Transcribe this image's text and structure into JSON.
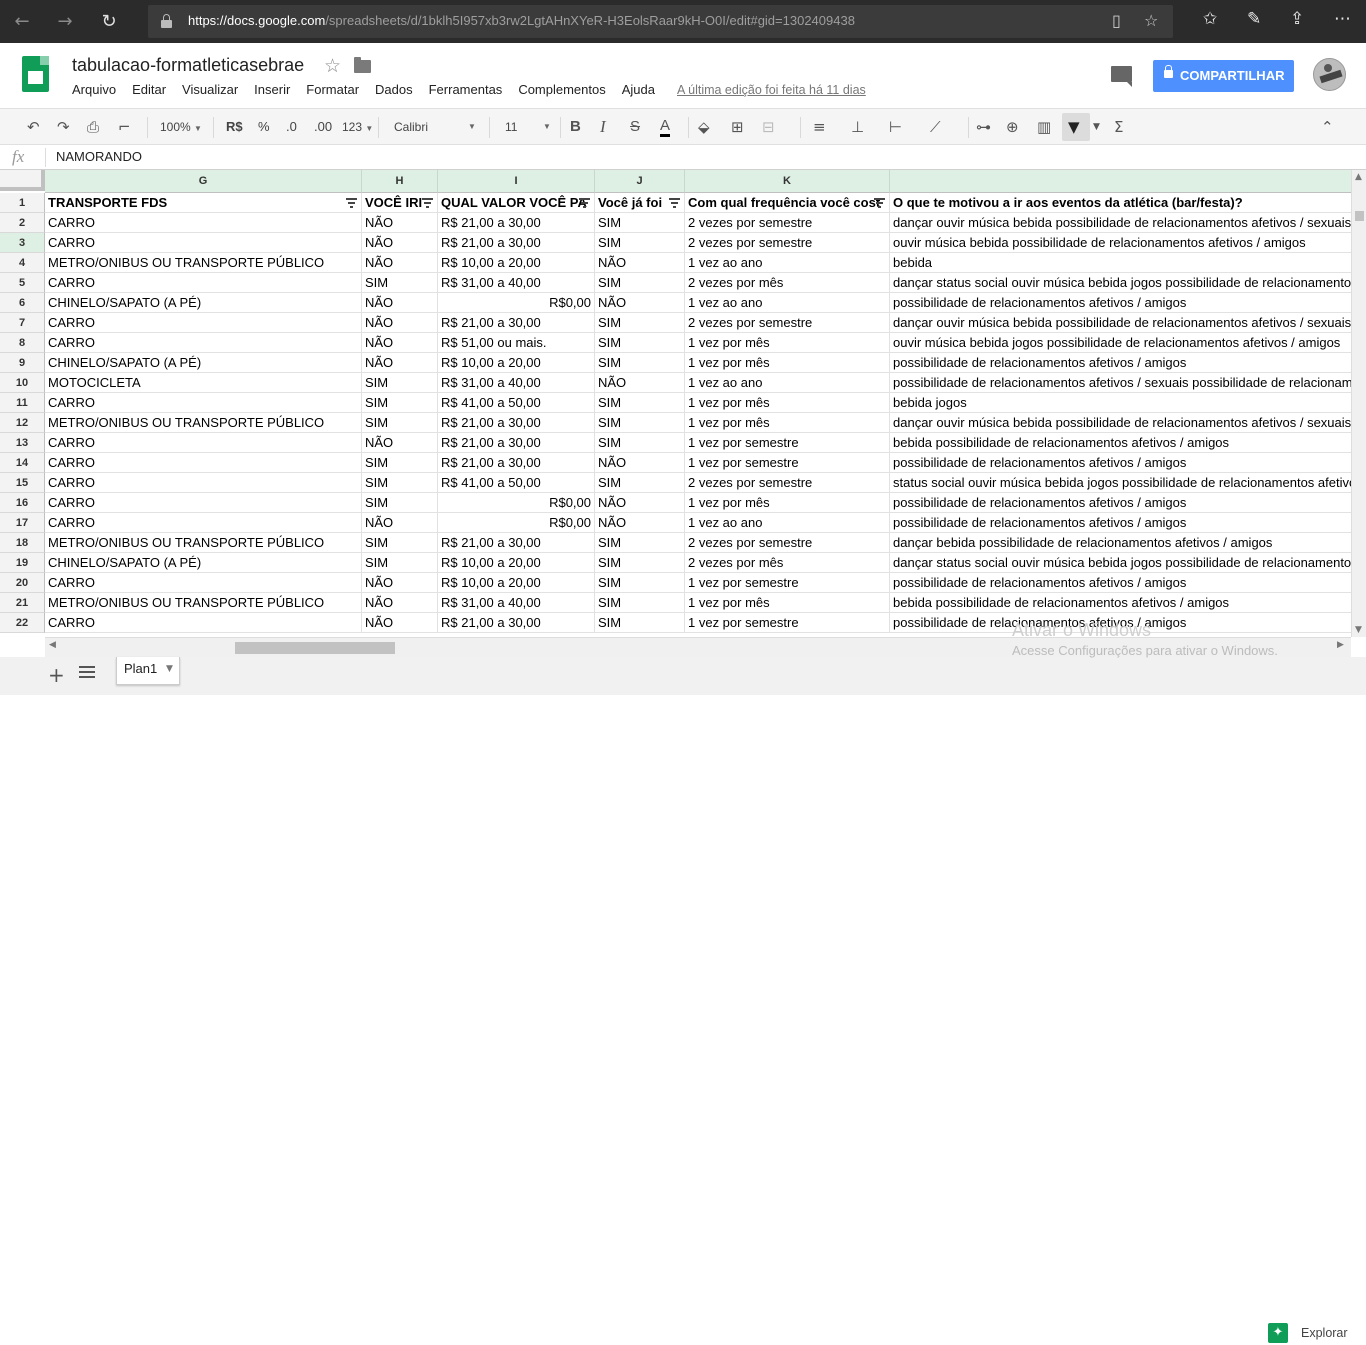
{
  "browser": {
    "url_host": "https://docs.google.com",
    "url_path": "/spreadsheets/d/1bklh5I957xb3rw2LgtAHnXYeR-H3EolsRaar9kH-O0I/edit#gid=1302409438"
  },
  "doc": {
    "title": "tabulacao-formatleticasebrae",
    "menu": [
      "Arquivo",
      "Editar",
      "Visualizar",
      "Inserir",
      "Formatar",
      "Dados",
      "Ferramentas",
      "Complementos",
      "Ajuda"
    ],
    "last_edit": "A última edição foi feita há 11 dias",
    "share_label": "COMPARTILHAR"
  },
  "toolbar": {
    "zoom": "100%",
    "currency": "R$",
    "percent": "%",
    "dec_less": ".0",
    "dec_more": ".00",
    "more_formats": "123",
    "font": "Calibri",
    "font_size": "11"
  },
  "formula": {
    "fx": "fx",
    "value": "NAMORANDO"
  },
  "sheet": {
    "columns": [
      "G",
      "H",
      "I",
      "J",
      "K",
      ""
    ],
    "header_row": [
      "TRANSPORTE FDS",
      "VOCÊ IRI",
      "QUAL VALOR VOCÊ PA",
      "Você já foi",
      "Com qual frequência você cost",
      "O que te motivou a ir aos eventos da atlética (bar/festa)?"
    ],
    "row_numbers": [
      "1",
      "2",
      "3",
      "4",
      "5",
      "6",
      "7",
      "8",
      "9",
      "10",
      "11",
      "12",
      "13",
      "14",
      "15",
      "16",
      "17",
      "18",
      "19",
      "20",
      "21",
      "22"
    ],
    "selected_row": "3",
    "rows": [
      [
        "CARRO",
        "NÃO",
        "R$ 21,00 a 30,00",
        "SIM",
        "2 vezes por semestre",
        "dançar ouvir música bebida possibilidade de relacionamentos afetivos / sexuais"
      ],
      [
        "CARRO",
        "NÃO",
        "R$ 21,00 a 30,00",
        "SIM",
        "2 vezes por semestre",
        "ouvir música bebida possibilidade de relacionamentos afetivos / amigos"
      ],
      [
        "METRO/ONIBUS OU TRANSPORTE PÚBLICO",
        "NÃO",
        "R$ 10,00 a 20,00",
        "NÃO",
        "1 vez ao ano",
        "bebida"
      ],
      [
        "CARRO",
        "SIM",
        "R$ 31,00 a 40,00",
        "SIM",
        "2 vezes por mês",
        "dançar status social ouvir música bebida jogos possibilidade de relacionamentos"
      ],
      [
        "CHINELO/SAPATO (A PÉ)",
        "NÃO",
        "R$0,00",
        "NÃO",
        "1 vez ao ano",
        "possibilidade de relacionamentos afetivos / amigos"
      ],
      [
        "CARRO",
        "NÃO",
        "R$ 21,00 a 30,00",
        "SIM",
        "2 vezes por semestre",
        "dançar ouvir música bebida possibilidade de relacionamentos afetivos / sexuais"
      ],
      [
        "CARRO",
        "NÃO",
        "R$ 51,00 ou mais.",
        "SIM",
        "1 vez por mês",
        "ouvir música bebida jogos possibilidade de relacionamentos afetivos / amigos"
      ],
      [
        "CHINELO/SAPATO (A PÉ)",
        "NÃO",
        "R$ 10,00 a 20,00",
        "SIM",
        "1 vez por mês",
        "possibilidade de relacionamentos afetivos / amigos"
      ],
      [
        "MOTOCICLETA",
        "SIM",
        "R$ 31,00 a 40,00",
        "NÃO",
        "1 vez ao ano",
        "possibilidade de relacionamentos afetivos / sexuais possibilidade de relacionamentos"
      ],
      [
        "CARRO",
        "SIM",
        "R$ 41,00 a 50,00",
        "SIM",
        "1 vez por mês",
        "bebida jogos"
      ],
      [
        "METRO/ONIBUS OU TRANSPORTE PÚBLICO",
        "SIM",
        "R$ 21,00 a 30,00",
        "SIM",
        "1 vez por mês",
        "dançar ouvir música bebida possibilidade de relacionamentos afetivos / sexuais"
      ],
      [
        "CARRO",
        "NÃO",
        "R$ 21,00 a 30,00",
        "SIM",
        "1 vez por semestre",
        "bebida possibilidade de relacionamentos afetivos / amigos"
      ],
      [
        "CARRO",
        "SIM",
        "R$ 21,00 a 30,00",
        "NÃO",
        "1 vez por semestre",
        "possibilidade de relacionamentos afetivos / amigos"
      ],
      [
        "CARRO",
        "SIM",
        "R$ 41,00 a 50,00",
        "SIM",
        "2 vezes por semestre",
        "status social ouvir música bebida jogos possibilidade de relacionamentos afetivos"
      ],
      [
        "CARRO",
        "SIM",
        "R$0,00",
        "NÃO",
        "1 vez por mês",
        "possibilidade de relacionamentos afetivos / amigos"
      ],
      [
        "CARRO",
        "NÃO",
        "R$0,00",
        "NÃO",
        "1 vez ao ano",
        "possibilidade de relacionamentos afetivos / amigos"
      ],
      [
        "METRO/ONIBUS OU TRANSPORTE PÚBLICO",
        "SIM",
        "R$ 21,00 a 30,00",
        "SIM",
        "2 vezes por semestre",
        "dançar bebida possibilidade de relacionamentos afetivos / amigos"
      ],
      [
        "CHINELO/SAPATO (A PÉ)",
        "SIM",
        "R$ 10,00 a 20,00",
        "SIM",
        "2 vezes por mês",
        "dançar status social ouvir música bebida jogos possibilidade de relacionamento"
      ],
      [
        "CARRO",
        "NÃO",
        "R$ 10,00 a 20,00",
        "SIM",
        "1 vez por semestre",
        "possibilidade de relacionamentos afetivos / amigos"
      ],
      [
        "METRO/ONIBUS OU TRANSPORTE PÚBLICO",
        "NÃO",
        "R$ 31,00 a 40,00",
        "SIM",
        "1 vez por mês",
        "bebida possibilidade de relacionamentos afetivos / amigos"
      ],
      [
        "CARRO",
        "NÃO",
        "R$ 21,00 a 30,00",
        "SIM",
        "1 vez por semestre",
        "possibilidade de relacionamentos afetivos / amigos"
      ]
    ]
  },
  "tabs": {
    "sheet_name": "Plan1",
    "explore_label": "Explorar"
  },
  "watermark": {
    "line1": "Ativar o Windows",
    "line2": "Acesse Configurações para ativar o Windows."
  },
  "colors": {
    "accent": "#4d90fe",
    "sheets_green": "#0f9d58",
    "selected_header": "#def0e3"
  }
}
